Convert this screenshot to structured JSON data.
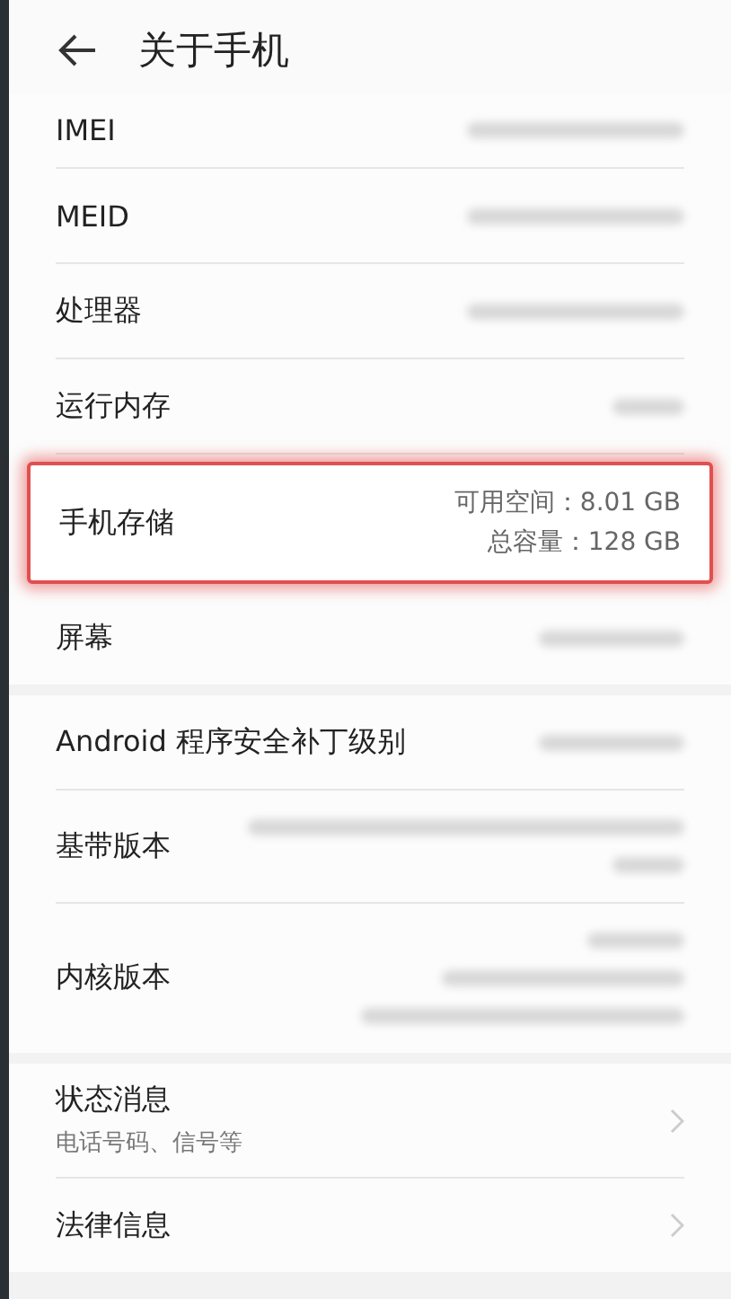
{
  "header": {
    "title": "关于手机"
  },
  "sections": [
    {
      "rows": [
        {
          "label": "IMEI",
          "kind": "blurred-long",
          "highlighted": false
        },
        {
          "label": "MEID",
          "kind": "blurred-long",
          "highlighted": false
        },
        {
          "label": "处理器",
          "kind": "blurred-long",
          "highlighted": false
        },
        {
          "label": "运行内存",
          "kind": "blurred-short",
          "highlighted": false
        },
        {
          "label": "手机存储",
          "kind": "text",
          "values": [
            "可用空间：8.01 GB",
            "总容量：128 GB"
          ],
          "highlighted": true
        },
        {
          "label": "屏幕",
          "kind": "blurred-medium",
          "highlighted": false
        }
      ]
    },
    {
      "rows": [
        {
          "label": "Android 程序安全补丁级别",
          "kind": "blurred-medium",
          "highlighted": false
        },
        {
          "label": "基带版本",
          "kind": "blurred-two-line",
          "highlighted": false
        },
        {
          "label": "内核版本",
          "kind": "blurred-three-line",
          "highlighted": false
        }
      ]
    },
    {
      "rows": [
        {
          "label": "状态消息",
          "sublabel": "电话号码、信号等",
          "kind": "chevron",
          "highlighted": false
        },
        {
          "label": "法律信息",
          "kind": "chevron",
          "highlighted": false
        }
      ]
    }
  ]
}
